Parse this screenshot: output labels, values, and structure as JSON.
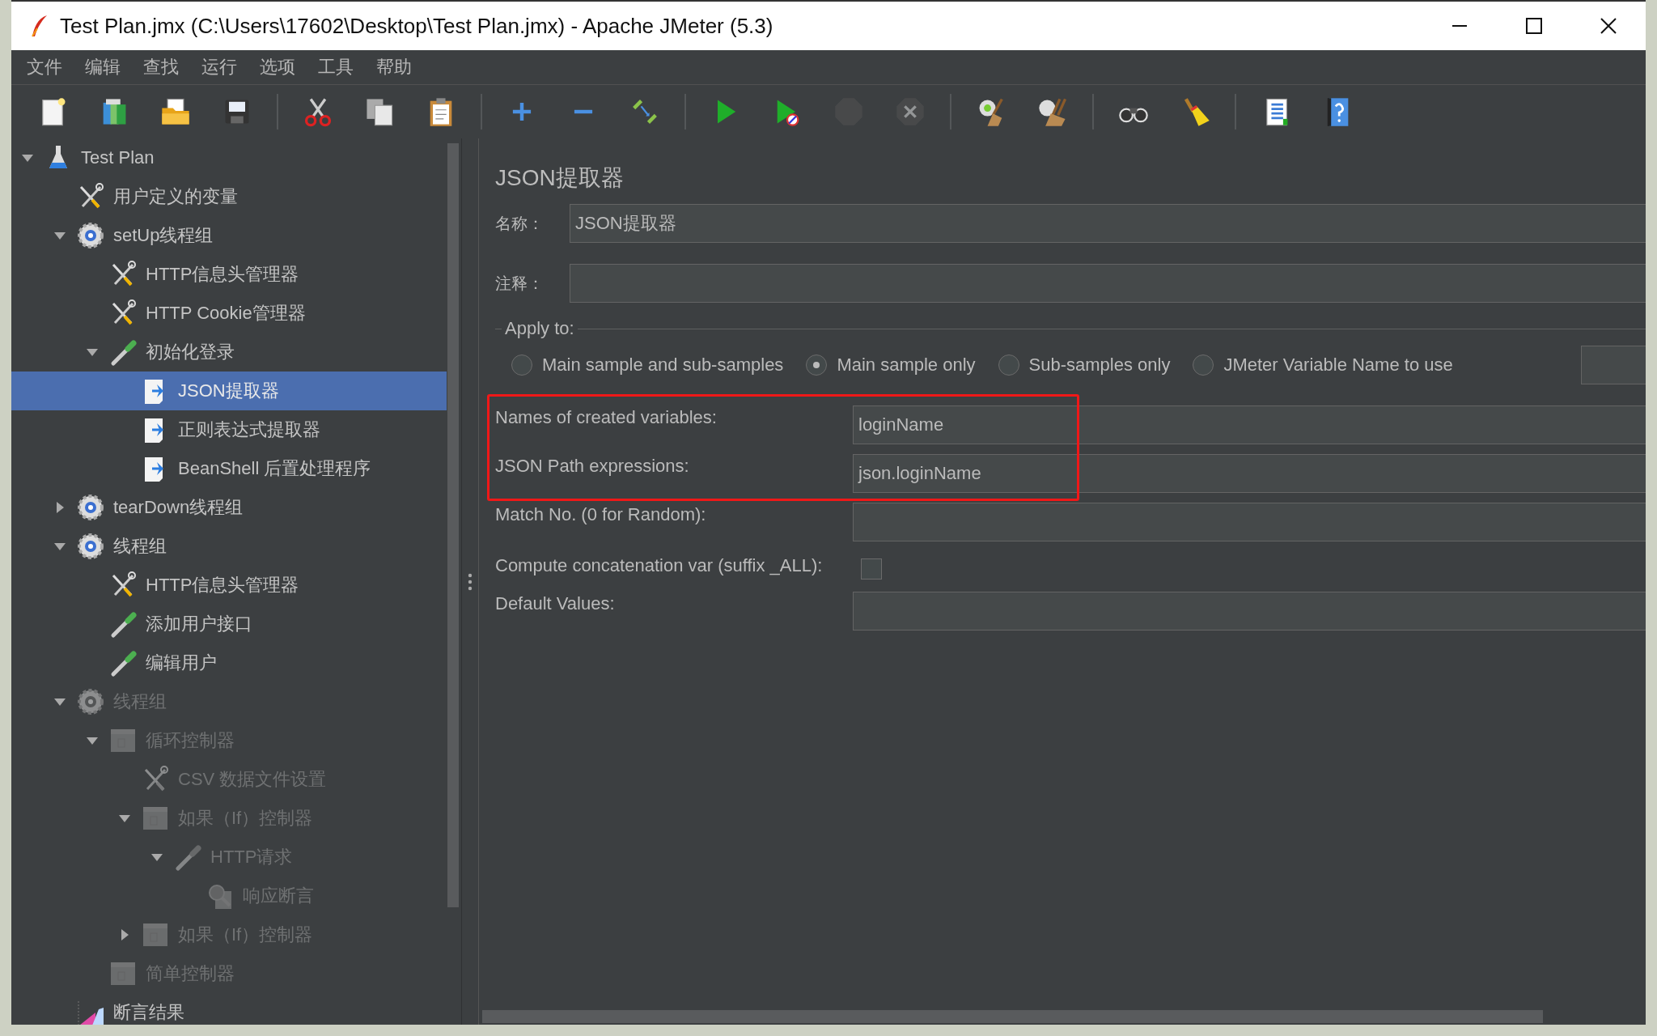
{
  "window": {
    "title": "Test Plan.jmx (C:\\Users\\17602\\Desktop\\Test Plan.jmx) - Apache JMeter (5.3)"
  },
  "menu": [
    "文件",
    "编辑",
    "查找",
    "运行",
    "选项",
    "工具",
    "帮助"
  ],
  "toolbar": [
    [
      {
        "kind": "new",
        "disabled": false
      },
      {
        "kind": "templates",
        "disabled": false
      },
      {
        "kind": "open",
        "disabled": false
      },
      {
        "kind": "save",
        "disabled": false
      }
    ],
    [
      {
        "kind": "cut",
        "disabled": false
      },
      {
        "kind": "copy",
        "disabled": false
      },
      {
        "kind": "paste",
        "disabled": false
      }
    ],
    [
      {
        "kind": "expand",
        "disabled": false
      },
      {
        "kind": "collapse",
        "disabled": false
      },
      {
        "kind": "toggle",
        "disabled": false
      }
    ],
    [
      {
        "kind": "start",
        "disabled": false
      },
      {
        "kind": "start-no-pauses",
        "disabled": false
      },
      {
        "kind": "stop",
        "disabled": true
      },
      {
        "kind": "shutdown",
        "disabled": true
      }
    ],
    [
      {
        "kind": "clear",
        "disabled": false
      },
      {
        "kind": "clear-all",
        "disabled": false
      }
    ],
    [
      {
        "kind": "search",
        "disabled": false
      },
      {
        "kind": "reset-search",
        "disabled": false
      }
    ],
    [
      {
        "kind": "function-helper",
        "disabled": false
      },
      {
        "kind": "help",
        "disabled": false
      }
    ]
  ],
  "tree": [
    {
      "label": "Test Plan",
      "kind": "test-plan",
      "expanded": true,
      "disabled": false,
      "selected": false,
      "children": [
        {
          "label": "用户定义的变量",
          "kind": "config",
          "disabled": false,
          "selected": false
        },
        {
          "label": "setUp线程组",
          "kind": "thread-group",
          "expanded": true,
          "disabled": false,
          "selected": false,
          "children": [
            {
              "label": "HTTP信息头管理器",
              "kind": "config",
              "disabled": false,
              "selected": false
            },
            {
              "label": "HTTP Cookie管理器",
              "kind": "config",
              "disabled": false,
              "selected": false
            },
            {
              "label": "初始化登录",
              "kind": "sampler",
              "expanded": true,
              "disabled": false,
              "selected": false,
              "children": [
                {
                  "label": "JSON提取器",
                  "kind": "post-processor",
                  "disabled": false,
                  "selected": true
                },
                {
                  "label": "正则表达式提取器",
                  "kind": "post-processor",
                  "disabled": false,
                  "selected": false
                },
                {
                  "label": "BeanShell 后置处理程序",
                  "kind": "post-processor",
                  "disabled": false,
                  "selected": false
                }
              ]
            }
          ]
        },
        {
          "label": "tearDown线程组",
          "kind": "thread-group",
          "expanded": false,
          "disabled": false,
          "selected": false
        },
        {
          "label": "线程组",
          "kind": "thread-group",
          "expanded": true,
          "disabled": false,
          "selected": false,
          "children": [
            {
              "label": "HTTP信息头管理器",
              "kind": "config",
              "disabled": false,
              "selected": false
            },
            {
              "label": "添加用户接口",
              "kind": "sampler",
              "disabled": false,
              "selected": false
            },
            {
              "label": "编辑用户",
              "kind": "sampler",
              "disabled": false,
              "selected": false
            }
          ]
        },
        {
          "label": "线程组",
          "kind": "thread-group",
          "expanded": true,
          "disabled": true,
          "selected": false,
          "children": [
            {
              "label": "循环控制器",
              "kind": "controller",
              "expanded": true,
              "disabled": true,
              "selected": false,
              "children": [
                {
                  "label": "CSV 数据文件设置",
                  "kind": "config",
                  "disabled": true,
                  "selected": false
                },
                {
                  "label": "如果（If）控制器",
                  "kind": "controller",
                  "expanded": true,
                  "disabled": true,
                  "selected": false,
                  "children": [
                    {
                      "label": "HTTP请求",
                      "kind": "sampler",
                      "expanded": true,
                      "disabled": true,
                      "selected": false,
                      "children": [
                        {
                          "label": "响应断言",
                          "kind": "assertion",
                          "disabled": true,
                          "selected": false
                        }
                      ]
                    }
                  ]
                },
                {
                  "label": "如果（If）控制器",
                  "kind": "controller",
                  "expanded": false,
                  "disabled": true,
                  "selected": false
                }
              ]
            },
            {
              "label": "简单控制器",
              "kind": "controller",
              "disabled": true,
              "selected": false
            }
          ]
        },
        {
          "label": "断言结果",
          "kind": "listener",
          "disabled": false,
          "selected": false
        }
      ]
    }
  ],
  "editor": {
    "title": "JSON提取器",
    "name": {
      "label": "名称：",
      "value": "JSON提取器"
    },
    "comment": {
      "label": "注释："
    },
    "apply_to": {
      "legend": "Apply to:",
      "options": [
        {
          "label": "Main sample and sub-samples",
          "selected": false
        },
        {
          "label": "Main sample only",
          "selected": true
        },
        {
          "label": "Sub-samples only",
          "selected": false
        },
        {
          "label": "JMeter Variable Name to use",
          "selected": false
        }
      ]
    },
    "fields": [
      {
        "kind": "text",
        "label": "Names of created variables:",
        "value": "loginName",
        "highlighted": true
      },
      {
        "kind": "text",
        "label": "JSON Path expressions:",
        "value": "json.loginName",
        "highlighted": true
      },
      {
        "kind": "text",
        "label": "Match No. (0 for Random):",
        "highlighted": false
      },
      {
        "kind": "checkbox",
        "label": "Compute concatenation var (suffix _ALL):",
        "checked": false,
        "highlighted": false
      },
      {
        "kind": "text",
        "label": "Default Values:",
        "highlighted": false
      }
    ]
  }
}
